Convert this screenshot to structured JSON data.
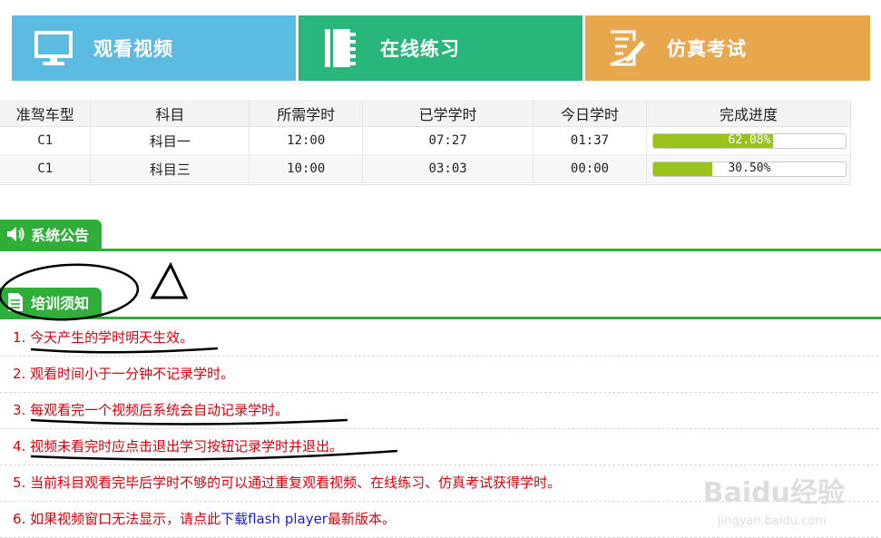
{
  "tiles": [
    {
      "label": "观看视频",
      "icon": "monitor-icon",
      "color": "#5bbbe0"
    },
    {
      "label": "在线练习",
      "icon": "notebook-icon",
      "color": "#29b67a"
    },
    {
      "label": "仿真考试",
      "icon": "exam-paper-icon",
      "color": "#e8a74d"
    }
  ],
  "table": {
    "headers": [
      "准驾车型",
      "科目",
      "所需学时",
      "已学学时",
      "今日学时",
      "完成进度"
    ],
    "rows": [
      {
        "vehicle": "C1",
        "subject": "科目一",
        "required": "12:00",
        "learned": "07:27",
        "today": "01:37",
        "progress_label": "62.08%",
        "progress": 0.6208
      },
      {
        "vehicle": "C1",
        "subject": "科目三",
        "required": "10:00",
        "learned": "03:03",
        "today": "00:00",
        "progress_label": "30.50%",
        "progress": 0.305
      }
    ]
  },
  "announcement": {
    "title": "系统公告",
    "icon": "speaker-icon"
  },
  "training": {
    "title": "培训须知",
    "icon": "document-icon",
    "items": [
      {
        "text": "1. 今天产生的学时明天生效。"
      },
      {
        "text": "2. 观看时间小于一分钟不记录学时。"
      },
      {
        "text": "3. 每观看完一个视频后系统会自动记录学时。"
      },
      {
        "text": "4. 视频未看完时应点击退出学习按钮记录学时并退出。"
      },
      {
        "text": "5. 当前科目观看完毕后学时不够的可以通过重复观看视频、在线练习、仿真考试获得学时。"
      },
      {
        "prefix": "6. 如果视频窗口无法显示，请点此",
        "link": "下载flash player",
        "suffix": "最新版本。"
      }
    ]
  },
  "colors": {
    "green": "#2fae3a",
    "progress": "#99c21a",
    "notice_text": "#d8000c",
    "link": "#1a1ad8"
  },
  "watermark": {
    "brand": "Baidu经验",
    "url": "jingyan.baidu.com"
  }
}
